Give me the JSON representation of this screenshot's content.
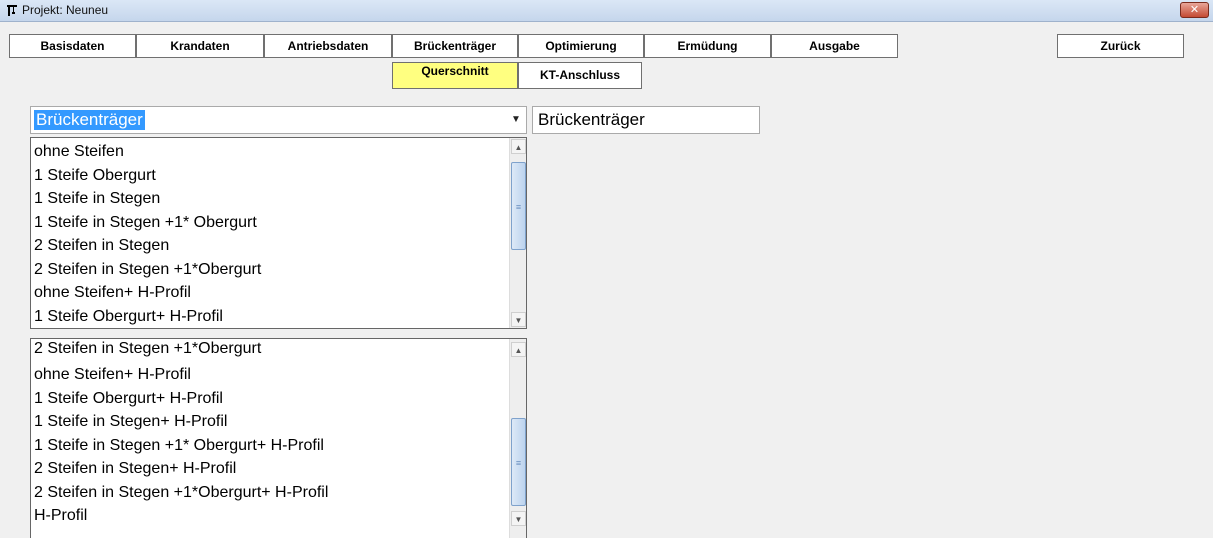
{
  "window": {
    "title": "Projekt: Neuneu",
    "close_label": "✕"
  },
  "tabs": [
    {
      "label": "Basisdaten"
    },
    {
      "label": "Krandaten"
    },
    {
      "label": "Antriebsdaten"
    },
    {
      "label": "Brückenträger"
    },
    {
      "label": "Optimierung"
    },
    {
      "label": "Ermüdung"
    },
    {
      "label": "Ausgabe"
    }
  ],
  "back_label": "Zurück",
  "subtabs": [
    {
      "label": "Querschnitt",
      "active": true
    },
    {
      "label": "KT-Anschluss",
      "active": false
    }
  ],
  "combo": {
    "value": "Brückenträger",
    "arrow": "▼"
  },
  "name_field": {
    "value": "Brückenträger"
  },
  "dropdown_list": {
    "items": [
      "ohne Steifen",
      "1 Steife Obergurt",
      "1 Steife in Stegen",
      "1 Steife in Stegen +1* Obergurt",
      "2 Steifen in Stegen",
      "2 Steifen in Stegen +1*Obergurt",
      "ohne Steifen+ H-Profil",
      "1 Steife Obergurt+ H-Profil"
    ]
  },
  "second_list": {
    "items": [
      "2 Steifen in Stegen +1*Obergurt",
      "ohne Steifen+ H-Profil",
      "1 Steife Obergurt+ H-Profil",
      "1 Steife in Stegen+ H-Profil",
      "1 Steife in Stegen +1* Obergurt+ H-Profil",
      "2 Steifen in Stegen+ H-Profil",
      "2 Steifen in Stegen +1*Obergurt+ H-Profil",
      "H-Profil"
    ]
  },
  "scroll": {
    "up": "▲",
    "down": "▼",
    "grip": "≡"
  },
  "colors": {
    "active_tab": "#ffff80",
    "selection": "#3399ff"
  },
  "icons": {
    "app": "crane-icon"
  }
}
